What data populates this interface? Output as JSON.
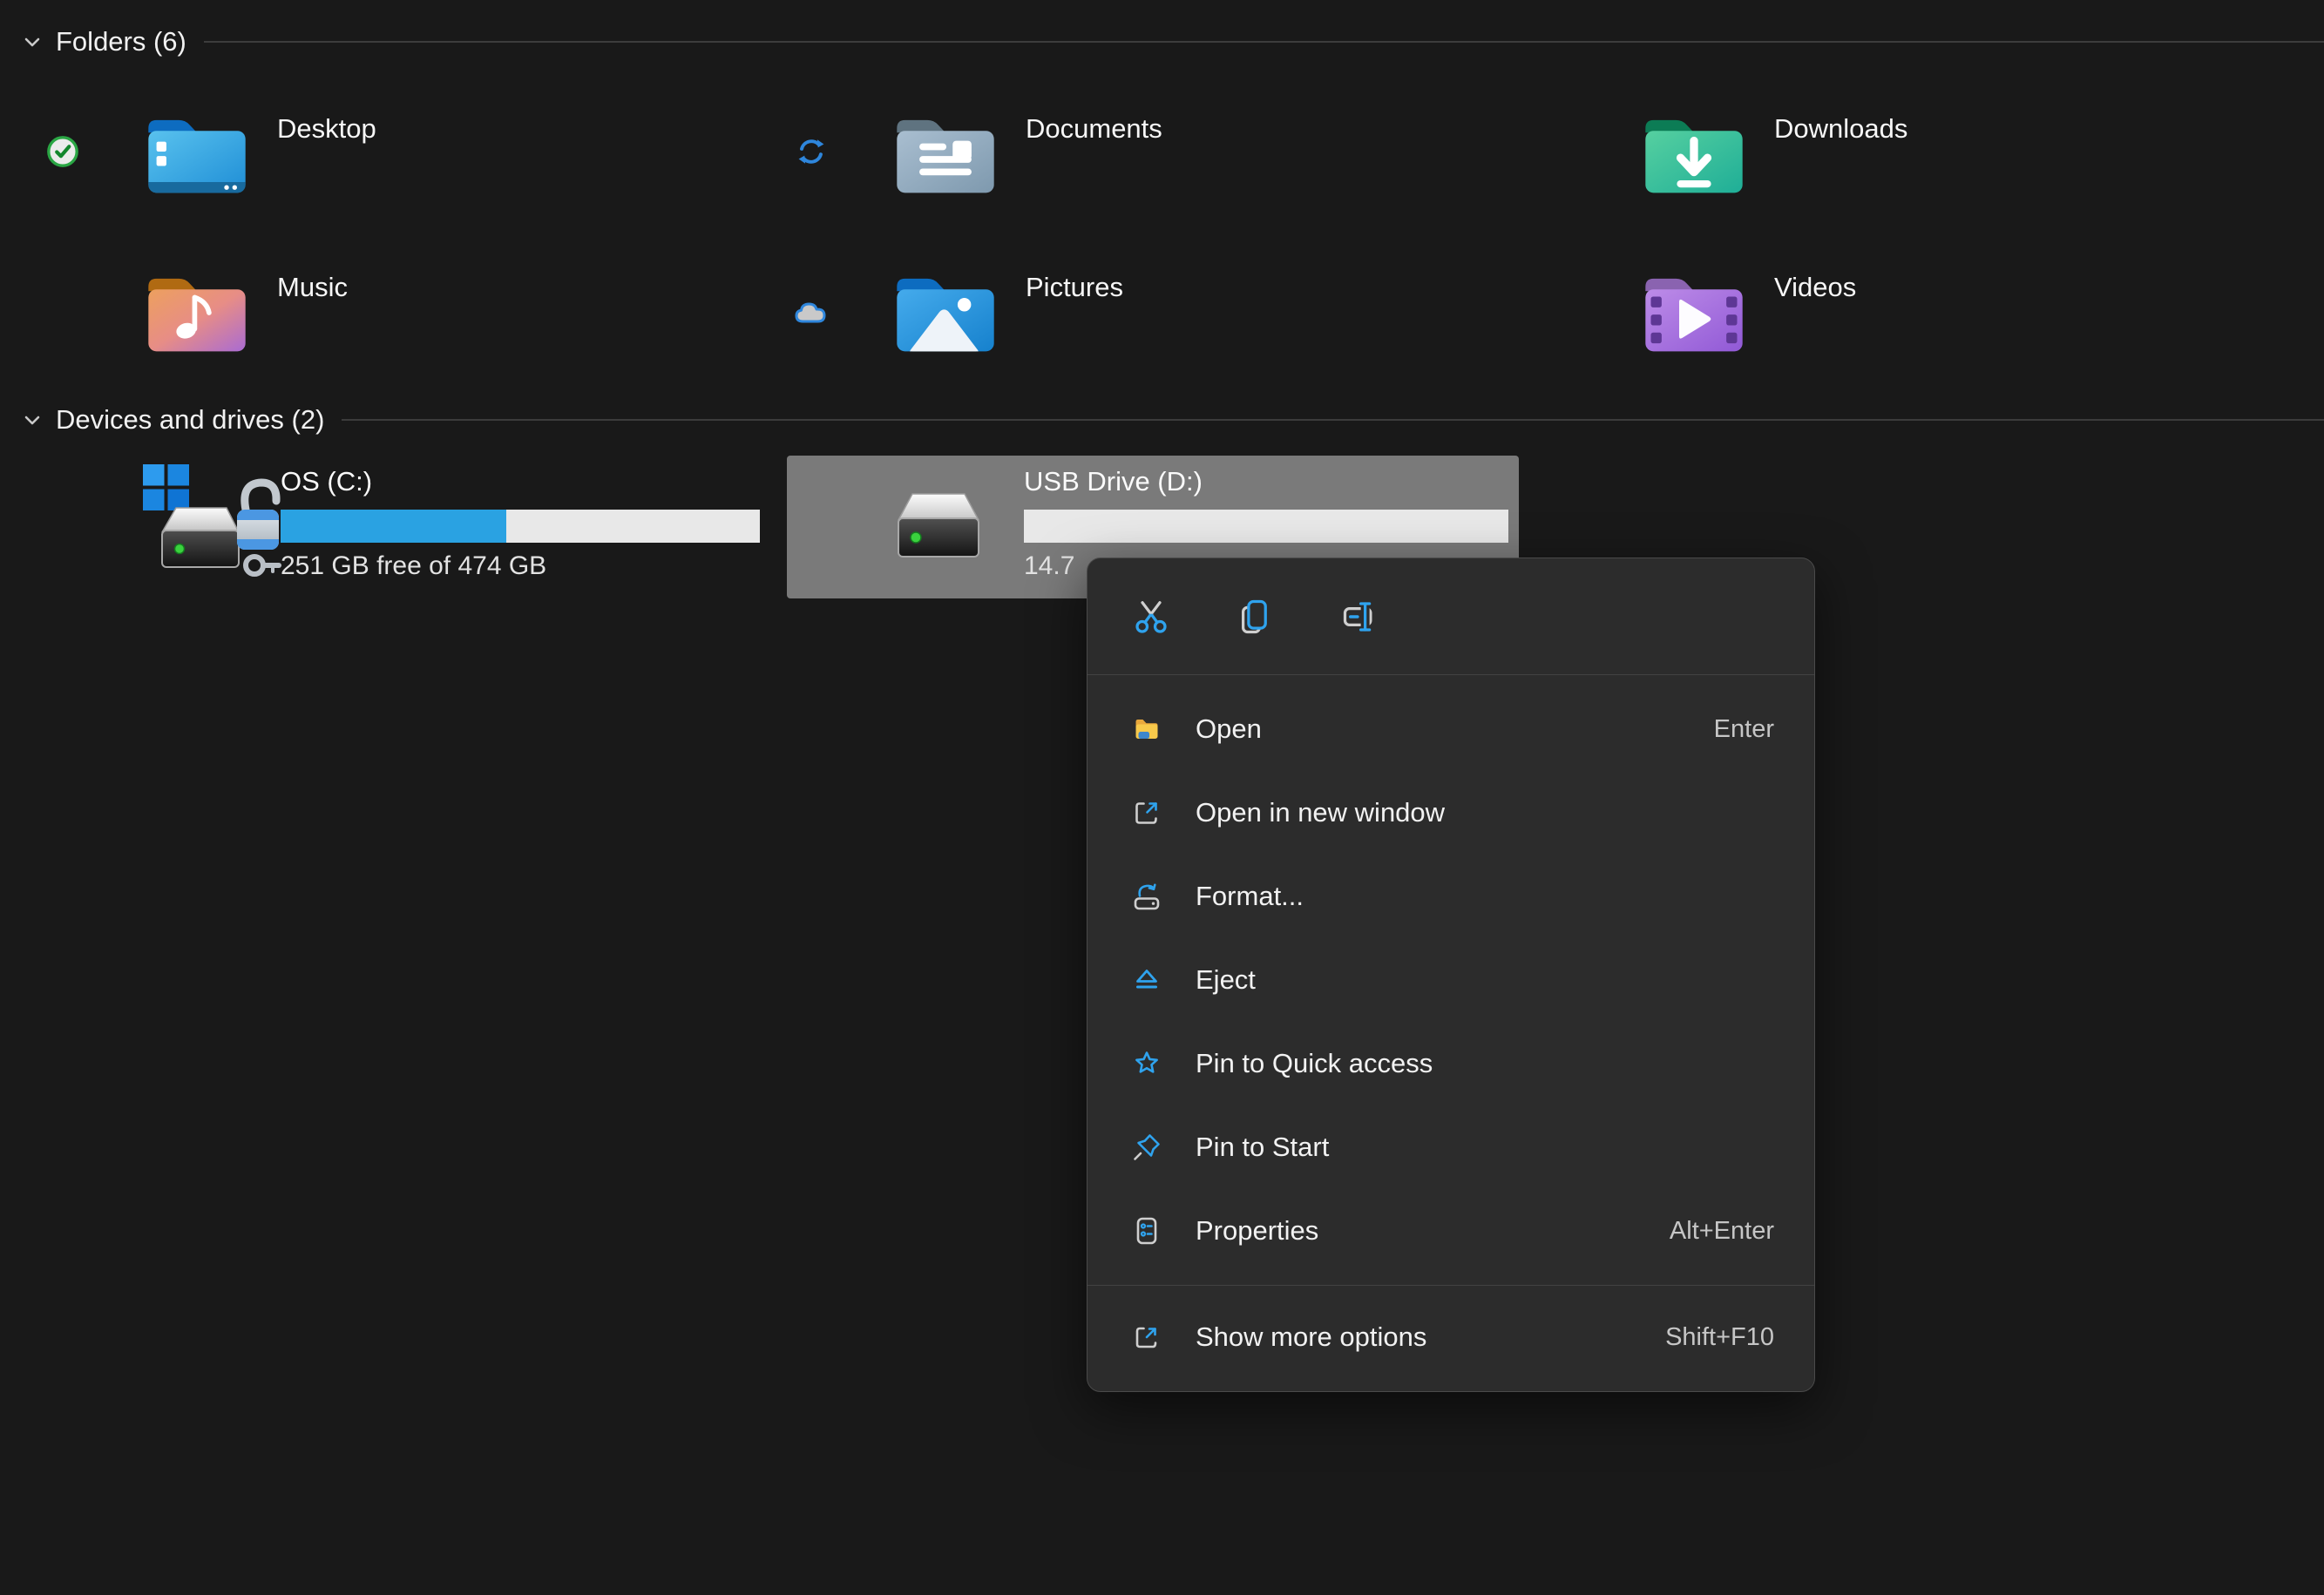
{
  "colors": {
    "background": "#191919",
    "selected_tile": "#7a7a7a",
    "menu_background": "#2c2c2c",
    "accent_blue": "#2fa3ee",
    "status_blue": "#2e86dc",
    "bar_fill_blue": "#2aa2e2",
    "bar_track": "#e8e8e8",
    "divider": "#3c3c3c"
  },
  "sections": {
    "folders": {
      "title": "Folders (6)",
      "items": [
        {
          "label": "Desktop",
          "icon": "desktop-folder-icon",
          "status_icon": "sync-complete-check-icon"
        },
        {
          "label": "Documents",
          "icon": "documents-folder-icon",
          "status_icon": "sync-in-progress-icon"
        },
        {
          "label": "Downloads",
          "icon": "downloads-folder-icon",
          "status_icon": ""
        },
        {
          "label": "Music",
          "icon": "music-folder-icon",
          "status_icon": ""
        },
        {
          "label": "Pictures",
          "icon": "pictures-folder-icon",
          "status_icon": "cloud-available-icon"
        },
        {
          "label": "Videos",
          "icon": "videos-folder-icon",
          "status_icon": ""
        }
      ]
    },
    "devices": {
      "title": "Devices and drives (2)",
      "drives": [
        {
          "name": "OS (C:)",
          "info": "251 GB free of 474 GB",
          "usage_fraction": 0.47,
          "icon": "os-drive-bitlocker-icon",
          "selected": false
        },
        {
          "name": "USB Drive (D:)",
          "info": "14.7",
          "usage_fraction": 0,
          "icon": "usb-drive-icon",
          "selected": true
        }
      ]
    }
  },
  "context_menu": {
    "quick_actions": [
      {
        "name": "cut"
      },
      {
        "name": "copy"
      },
      {
        "name": "rename"
      }
    ],
    "items": [
      {
        "label": "Open",
        "shortcut": "Enter",
        "icon": "open-folder-icon"
      },
      {
        "label": "Open in new window",
        "shortcut": "",
        "icon": "open-new-window-icon"
      },
      {
        "label": "Format...",
        "shortcut": "",
        "icon": "format-drive-icon"
      },
      {
        "label": "Eject",
        "shortcut": "",
        "icon": "eject-icon"
      },
      {
        "label": "Pin to Quick access",
        "shortcut": "",
        "icon": "pin-quick-access-star-icon"
      },
      {
        "label": "Pin to Start",
        "shortcut": "",
        "icon": "pin-to-start-icon"
      },
      {
        "label": "Properties",
        "shortcut": "Alt+Enter",
        "icon": "properties-icon"
      }
    ],
    "footer": {
      "label": "Show more options",
      "shortcut": "Shift+F10",
      "icon": "show-more-options-icon"
    }
  }
}
